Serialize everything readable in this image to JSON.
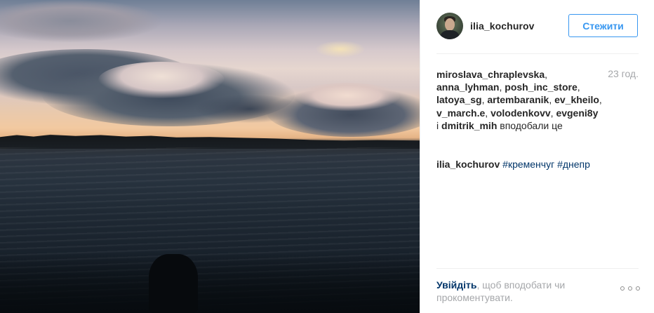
{
  "post": {
    "author": "ilia_kochurov",
    "follow_label": "Стежити",
    "time": "23 год.",
    "likes": {
      "users": [
        "miroslava_chraplevska",
        "anna_lyhman",
        "posh_inc_store",
        "latoya_sg",
        "artembaranik",
        "ev_kheilo",
        "v_march.e",
        "volodenkovv",
        "evgeni8y",
        "dmitrik_mih"
      ],
      "and_word": "і",
      "suffix": "вподобали це"
    },
    "caption": {
      "author": "ilia_kochurov",
      "tags": [
        "#кременчуг",
        "#днепр"
      ]
    },
    "footer": {
      "login_link": "Увійдіть",
      "text": ", щоб вподобати чи прокоментувати."
    }
  },
  "icons": {
    "more": "more-options-icon"
  },
  "colors": {
    "accent": "#3897f0",
    "link": "#003569",
    "muted": "#a5a7aa",
    "text": "#262626"
  }
}
